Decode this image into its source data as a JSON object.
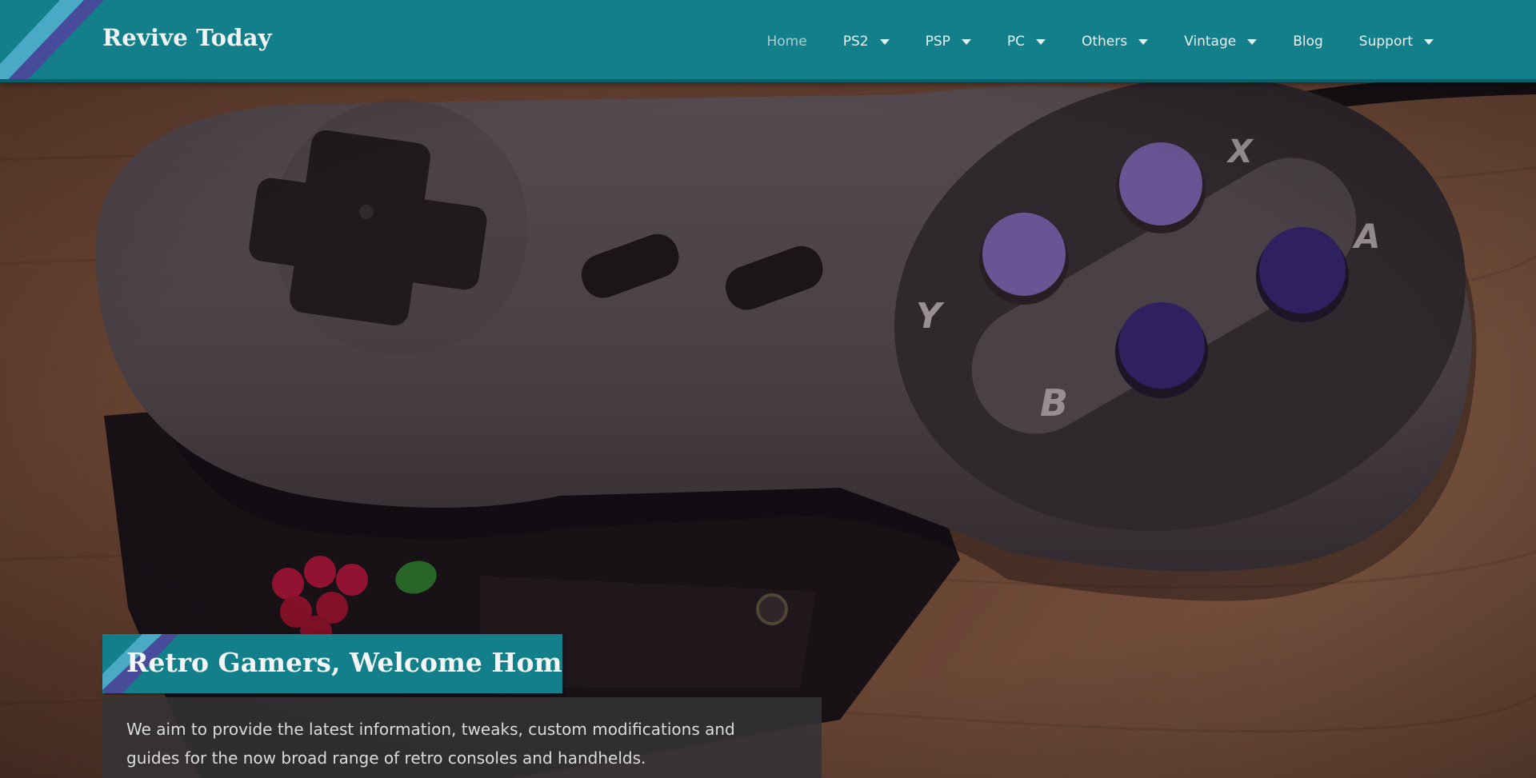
{
  "site": {
    "title": "Revive Today"
  },
  "nav": {
    "items": [
      {
        "label": "Home",
        "active": true,
        "dropdown": false
      },
      {
        "label": "PS2",
        "active": false,
        "dropdown": true
      },
      {
        "label": "PSP",
        "active": false,
        "dropdown": true
      },
      {
        "label": "PC",
        "active": false,
        "dropdown": true
      },
      {
        "label": "Others",
        "active": false,
        "dropdown": true
      },
      {
        "label": "Vintage",
        "active": false,
        "dropdown": true
      },
      {
        "label": "Blog",
        "active": false,
        "dropdown": false
      },
      {
        "label": "Support",
        "active": false,
        "dropdown": true
      }
    ]
  },
  "hero": {
    "title": "Retro Gamers, Welcome Home",
    "description": "We aim to provide the latest information, tweaks, custom modifications and guides for the now broad range of retro consoles and handhelds.",
    "image_subject": "retro gamepad controller on Raspberry Pi case",
    "controller_buttons": [
      "X",
      "A",
      "Y",
      "B"
    ]
  },
  "colors": {
    "header_bg": "#127f8a",
    "accent_light_blue": "#4aa9c4",
    "accent_purple": "#4a4a9a",
    "text_light": "#f1f4f4",
    "desc_box_bg": "#343234"
  },
  "icons": {
    "dropdown": "caret-down-icon",
    "brand_stripe": "diagonal-stripe-icon"
  }
}
